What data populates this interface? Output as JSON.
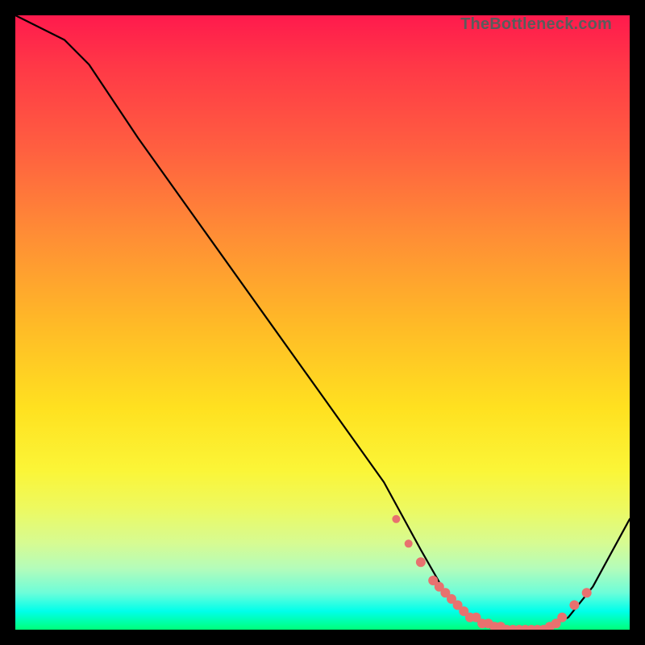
{
  "attribution": "TheBottleneck.com",
  "chart_data": {
    "type": "line",
    "title": "",
    "xlabel": "",
    "ylabel": "",
    "xlim": [
      0,
      100
    ],
    "ylim": [
      0,
      100
    ],
    "series": [
      {
        "name": "bottleneck-curve",
        "x": [
          0,
          8,
          12,
          20,
          30,
          40,
          50,
          60,
          66,
          70,
          74,
          78,
          82,
          86,
          90,
          94,
          100
        ],
        "values": [
          100,
          96,
          92,
          80,
          66,
          52,
          38,
          24,
          13,
          6,
          2,
          0,
          0,
          0,
          2,
          7,
          18
        ]
      }
    ],
    "markers": {
      "name": "highlight-dots",
      "x": [
        62,
        64,
        66,
        68,
        69,
        70,
        71,
        72,
        73,
        74,
        75,
        76,
        77,
        78,
        79,
        80,
        81,
        82,
        83,
        84,
        85,
        86,
        87,
        88,
        89,
        91,
        93
      ],
      "values": [
        18,
        14,
        11,
        8,
        7,
        6,
        5,
        4,
        3,
        2,
        2,
        1,
        1,
        0.5,
        0.5,
        0,
        0,
        0,
        0,
        0,
        0,
        0,
        0.5,
        1,
        2,
        4,
        6
      ],
      "radius": [
        5,
        5,
        6,
        6,
        6,
        6,
        6,
        6,
        6,
        6,
        6,
        6,
        6,
        6,
        6,
        6,
        6,
        6,
        6,
        6,
        6,
        6,
        6,
        6,
        6,
        6,
        6
      ]
    }
  }
}
